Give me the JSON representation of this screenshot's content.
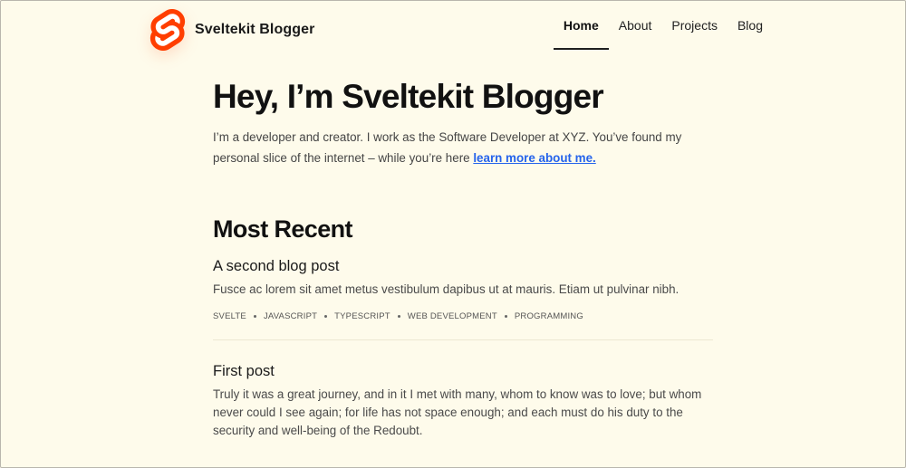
{
  "header": {
    "brand_name": "Sveltekit Blogger",
    "nav": [
      {
        "label": "Home",
        "active": true
      },
      {
        "label": "About",
        "active": false
      },
      {
        "label": "Projects",
        "active": false
      },
      {
        "label": "Blog",
        "active": false
      }
    ]
  },
  "hero": {
    "title": "Hey, I’m Sveltekit Blogger",
    "intro_text": "I’m a developer and creator. I work as the Software Developer at XYZ. You’ve found my personal slice of the internet –  while you’re here ",
    "intro_link": "learn more about me."
  },
  "recent": {
    "title": "Most Recent",
    "posts": [
      {
        "title": "A second blog post",
        "excerpt": "Fusce ac lorem sit amet metus vestibulum dapibus ut at mauris. Etiam ut pulvinar nibh.",
        "tags": [
          "svelte",
          "javascript",
          "typescript",
          "web development",
          "programming"
        ]
      },
      {
        "title": "First post",
        "excerpt": "Truly it was a great journey, and in it I met with many, whom to know was to love; but whom never could I see again; for life has not space enough; and each must do his duty to the security and well-being of the Redoubt.",
        "tags": []
      }
    ]
  },
  "colors": {
    "background": "#fefbeb",
    "link": "#2563eb",
    "logo_orange": "#ff3e00"
  }
}
